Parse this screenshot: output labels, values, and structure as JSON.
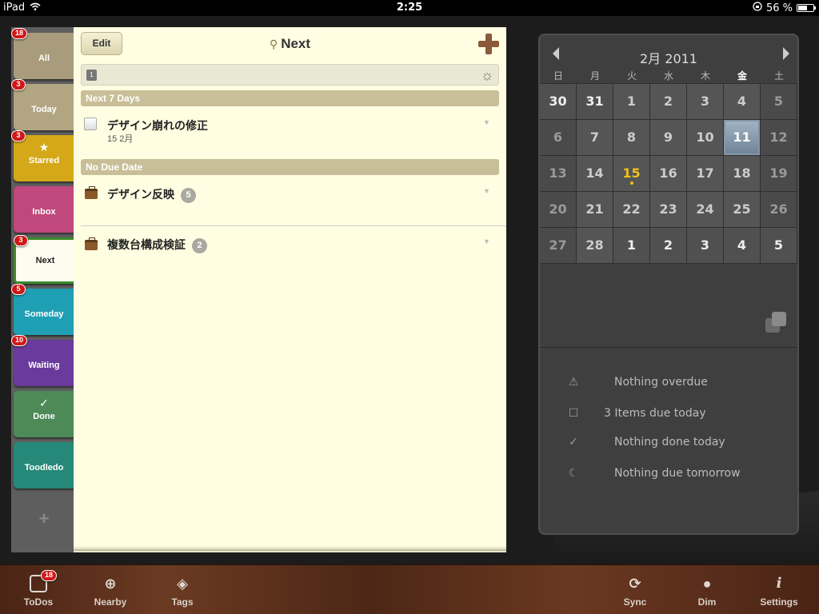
{
  "status": {
    "carrier": "iPad",
    "time": "2:25",
    "battery": "56 %"
  },
  "tabs": [
    {
      "label": "All",
      "badge": "18",
      "color": "#a89c7c"
    },
    {
      "label": "Today",
      "badge": "3",
      "color": "#b2a682"
    },
    {
      "label": "Starred",
      "badge": "3",
      "color": "#d4a818"
    },
    {
      "label": "Inbox",
      "badge": "",
      "color": "#c0487c"
    },
    {
      "label": "Next",
      "badge": "3",
      "color": "#fdfcf0"
    },
    {
      "label": "Someday",
      "badge": "5",
      "color": "#1f9fb4"
    },
    {
      "label": "Waiting",
      "badge": "10",
      "color": "#6a3a9c"
    },
    {
      "label": "Done",
      "badge": "",
      "color": "#4d8a58"
    },
    {
      "label": "Toodledo",
      "badge": "",
      "color": "#268878"
    }
  ],
  "notebook": {
    "edit_label": "Edit",
    "title": "Next",
    "cal_mini": "1",
    "sections": [
      {
        "label": "Next 7 Days"
      },
      {
        "label": "No Due Date"
      }
    ],
    "tasks": [
      {
        "name": "デザイン崩れの修正",
        "date": "15 2月"
      }
    ],
    "projects": [
      {
        "name": "デザイン反映",
        "count": "5"
      },
      {
        "name": "複数台構成検証",
        "count": "2"
      }
    ]
  },
  "calendar": {
    "month": "2月 2011",
    "weekdays": [
      "日",
      "月",
      "火",
      "水",
      "木",
      "金",
      "土"
    ],
    "days": [
      "30",
      "31",
      "1",
      "2",
      "3",
      "4",
      "5",
      "6",
      "7",
      "8",
      "9",
      "10",
      "11",
      "12",
      "13",
      "14",
      "15",
      "16",
      "17",
      "18",
      "19",
      "20",
      "21",
      "22",
      "23",
      "24",
      "25",
      "26",
      "27",
      "28",
      "1",
      "2",
      "3",
      "4",
      "5"
    ],
    "selected": "11",
    "today": "15"
  },
  "summary": [
    {
      "icon": "warning-icon",
      "text": "Nothing overdue"
    },
    {
      "icon": "checkbox-icon",
      "text": "3 Items due today"
    },
    {
      "icon": "checkmark-icon",
      "text": "Nothing done today"
    },
    {
      "icon": "moon-icon",
      "text": "Nothing due tomorrow"
    }
  ],
  "toolbar": {
    "todos": "ToDos",
    "todos_badge": "18",
    "nearby": "Nearby",
    "tags": "Tags",
    "sync": "Sync",
    "dim": "Dim",
    "settings": "Settings"
  }
}
